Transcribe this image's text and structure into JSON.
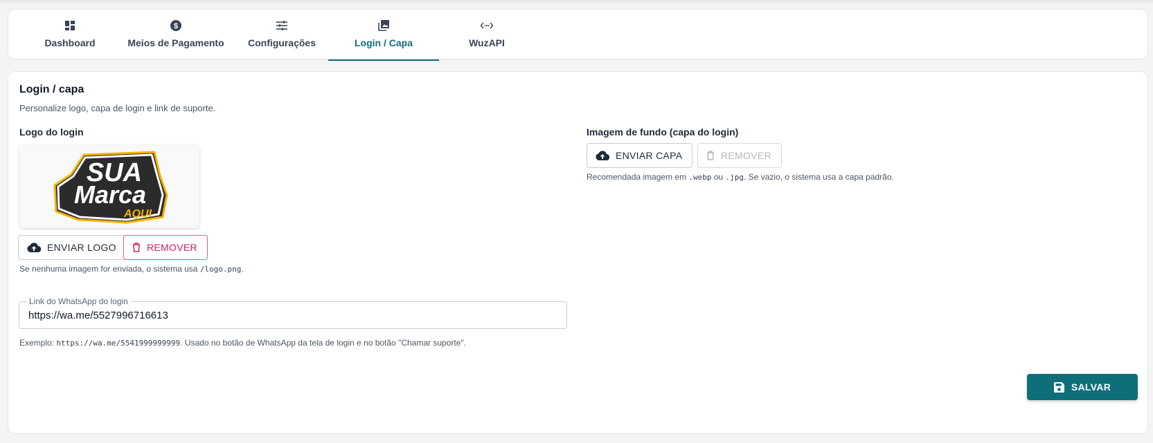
{
  "tabs": [
    {
      "label": "Dashboard",
      "icon": "dashboard-icon"
    },
    {
      "label": "Meios de Pagamento",
      "icon": "dollar-circle-icon"
    },
    {
      "label": "Configurações",
      "icon": "sliders-icon"
    },
    {
      "label": "Login / Capa",
      "icon": "image-stack-icon",
      "active": true
    },
    {
      "label": "WuzAPI",
      "icon": "api-icon"
    }
  ],
  "section": {
    "title": "Login / capa",
    "subtitle": "Personalize logo, capa de login e link de suporte."
  },
  "logo": {
    "label": "Logo do login",
    "image_text": {
      "line1": "SUA",
      "line2": "Marca",
      "line3": "AQUI"
    },
    "upload_button": "ENVIAR LOGO",
    "remove_button": "REMOVER",
    "hint_prefix": "Se nenhuma imagem for enviada, o sistema usa ",
    "hint_code": "/logo.png",
    "hint_suffix": "."
  },
  "cover": {
    "label": "Imagem de fundo (capa do login)",
    "upload_button": "ENVIAR CAPA",
    "remove_button": "REMOVER",
    "remove_disabled": true,
    "hint_prefix": "Recomendada imagem em ",
    "hint_code1": ".webp",
    "hint_mid": " ou ",
    "hint_code2": ".jpg",
    "hint_suffix": ". Se vazio, o sistema usa a capa padrão."
  },
  "whatsapp": {
    "label": "Link do WhatsApp do login",
    "value": "https://wa.me/5527996716613",
    "hint_prefix": "Exemplo: ",
    "hint_code": "https://wa.me/5541999999999",
    "hint_suffix": ". Usado no botão de WhatsApp da tela de login e no botão \"Chamar suporte\"."
  },
  "save_button": "SALVAR",
  "colors": {
    "accent": "#0e6e7a",
    "danger": "#d81b60",
    "logo_yellow": "#f5b400"
  }
}
